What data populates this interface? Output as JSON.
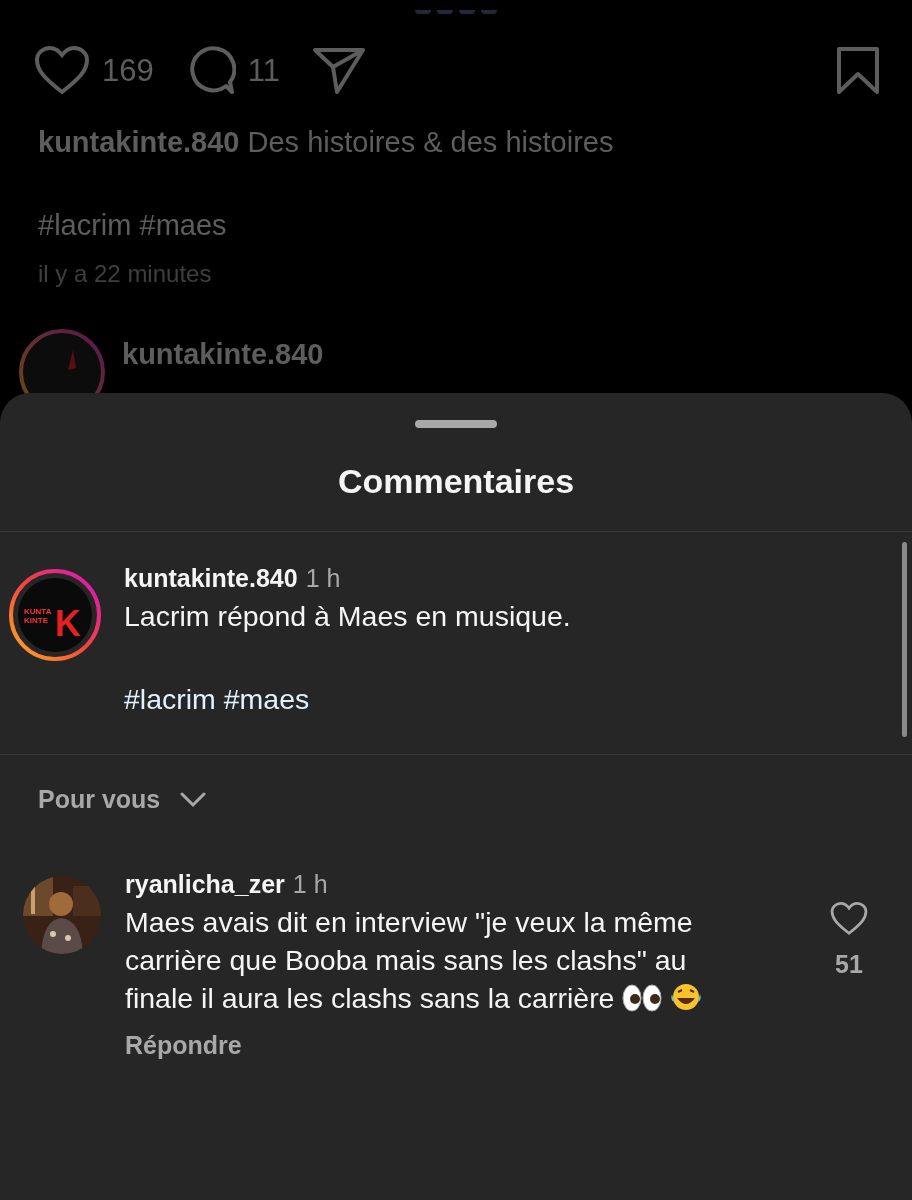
{
  "post": {
    "likes": "169",
    "comments": "11",
    "caption_user": "kuntakinte.840",
    "caption": "Des histoires & des histoires",
    "hashtags": "#lacrim #maes",
    "time": "il y a 22 minutes",
    "author": "kuntakinte.840"
  },
  "sheet": {
    "title": "Commentaires",
    "caption": {
      "user": "kuntakinte.840",
      "time": "1 h",
      "text": "Lacrim répond à Maes en musique.",
      "hashtags": "#lacrim #maes",
      "logo_text": [
        "KUNTA",
        "KINTE"
      ],
      "logo_mark": "K"
    },
    "filter": "Pour vous",
    "comments": [
      {
        "user": "ryanlicha_zer",
        "time": "1 h",
        "text": "Maes avais dit en interview \"je veux la même carrière que Booba mais sans les clashs\" au finale il aura les clashs sans la carrière",
        "likes": "51",
        "liked": false,
        "reply": "Répondre"
      }
    ]
  }
}
